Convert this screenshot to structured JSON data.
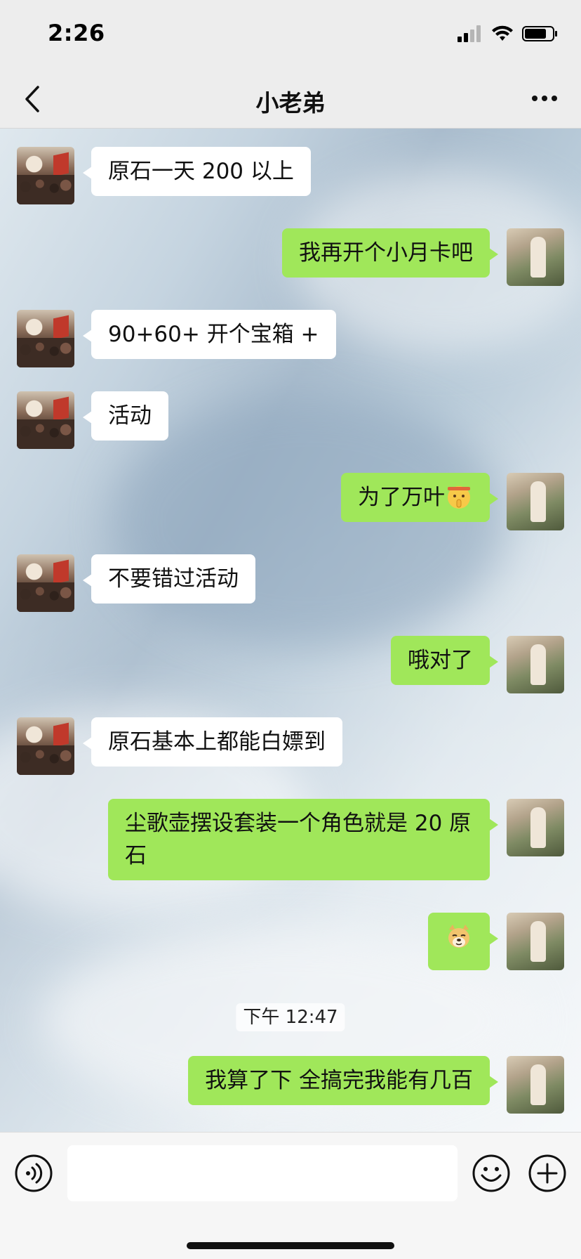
{
  "status_bar": {
    "time": "2:26"
  },
  "nav": {
    "title": "小老弟",
    "back_icon": "chevron-left-icon",
    "more_icon": "more-dots-icon"
  },
  "messages": [
    {
      "side": "friend",
      "text": "原石一天 200 以上"
    },
    {
      "side": "me",
      "text": "我再开个小月卡吧"
    },
    {
      "side": "friend",
      "text": "90+60+ 开个宝箱 +"
    },
    {
      "side": "friend",
      "text": "活动"
    },
    {
      "side": "me",
      "text": "为了万叶",
      "emoji": "shushing-face-emoji"
    },
    {
      "side": "friend",
      "text": "不要错过活动"
    },
    {
      "side": "me",
      "text": "哦对了"
    },
    {
      "side": "friend",
      "text": "原石基本上都能白嫖到"
    },
    {
      "side": "me",
      "text": "尘歌壶摆设套装一个角色就是 20 原石"
    },
    {
      "side": "me",
      "text": "",
      "emoji": "doge-emoji"
    },
    {
      "side": "me",
      "text": "我算了下 全搞完我能有几百"
    }
  ],
  "timestamp": "下午 12:47",
  "input": {
    "value": "",
    "voice_icon": "voice-icon",
    "emoji_icon": "emoji-icon",
    "plus_icon": "plus-icon"
  },
  "colors": {
    "my_bubble": "#a0e75a",
    "friend_bubble": "#ffffff",
    "bar_background": "#ededed"
  }
}
